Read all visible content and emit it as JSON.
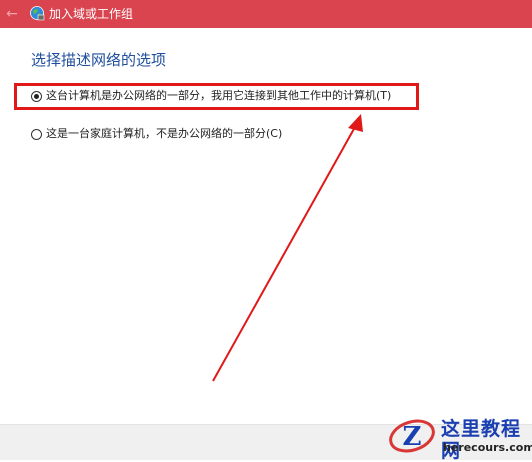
{
  "window": {
    "title": "加入域或工作组",
    "back_icon": "back-arrow-icon",
    "app_icon": "network-globe-icon"
  },
  "main": {
    "heading": "选择描述网络的选项",
    "options": [
      {
        "label": "这台计算机是办公网络的一部分，我用它连接到其他工作中的计算机(T)",
        "checked": true
      },
      {
        "label": "这是一台家庭计算机，不是办公网络的一部分(C)",
        "checked": false
      }
    ]
  },
  "watermark": {
    "cn": "这里教程网",
    "en": "herecours.com",
    "logo_icon": "z-logo-icon"
  },
  "colors": {
    "titlebar": "#d9444f",
    "heading": "#1f4e9d",
    "highlight": "#e01818",
    "arrow": "#e01818"
  }
}
